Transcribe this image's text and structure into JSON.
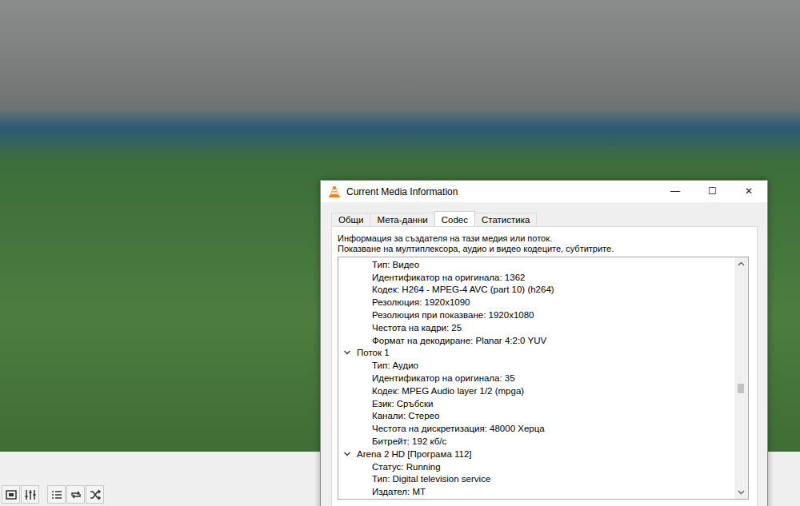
{
  "window": {
    "title": "Current Media Information",
    "controls": [
      "—",
      "☐",
      "✕"
    ]
  },
  "tabs": [
    {
      "label": "Общи",
      "selected": false
    },
    {
      "label": "Мета-данни",
      "selected": false
    },
    {
      "label": "Codec",
      "selected": true
    },
    {
      "label": "Статистика",
      "selected": false
    }
  ],
  "description": [
    "Информация за създателя на тази медия или поток.",
    "Показване на мултиплексора, аудио и видео кодеците, субтитрите."
  ],
  "tree": [
    {
      "kind": "leaf",
      "text": "Тип: Видео"
    },
    {
      "kind": "leaf",
      "text": "Идентификатор на оригинала: 1362"
    },
    {
      "kind": "leaf",
      "text": "Кодек: H264 - MPEG-4 AVC (part 10) (h264)"
    },
    {
      "kind": "leaf",
      "text": "Резолюция: 1920x1090"
    },
    {
      "kind": "leaf",
      "text": "Резолюция при показване: 1920x1080"
    },
    {
      "kind": "leaf",
      "text": "Честота на кадри: 25"
    },
    {
      "kind": "leaf",
      "text": "Формат на декодиране: Planar 4:2:0 YUV"
    },
    {
      "kind": "group",
      "text": "Поток 1",
      "expanded": true
    },
    {
      "kind": "leaf",
      "text": "Тип: Аудио"
    },
    {
      "kind": "leaf",
      "text": "Идентификатор на оригинала: 35"
    },
    {
      "kind": "leaf",
      "text": "Кодек: MPEG Audio layer 1/2 (mpga)"
    },
    {
      "kind": "leaf",
      "text": "Език: Сръбски"
    },
    {
      "kind": "leaf",
      "text": "Канали: Стерео"
    },
    {
      "kind": "leaf",
      "text": "Честота на дискретизация: 48000 Херца"
    },
    {
      "kind": "leaf",
      "text": "Битрейт: 192 кб/с"
    },
    {
      "kind": "group",
      "text": "Arena 2 HD [Програма 112]",
      "expanded": true
    },
    {
      "kind": "leaf",
      "text": "Статус: Running"
    },
    {
      "kind": "leaf",
      "text": "Тип: Digital television service"
    },
    {
      "kind": "leaf",
      "text": "Издател: MT"
    }
  ],
  "scrollbar": {
    "level": 0.55
  }
}
